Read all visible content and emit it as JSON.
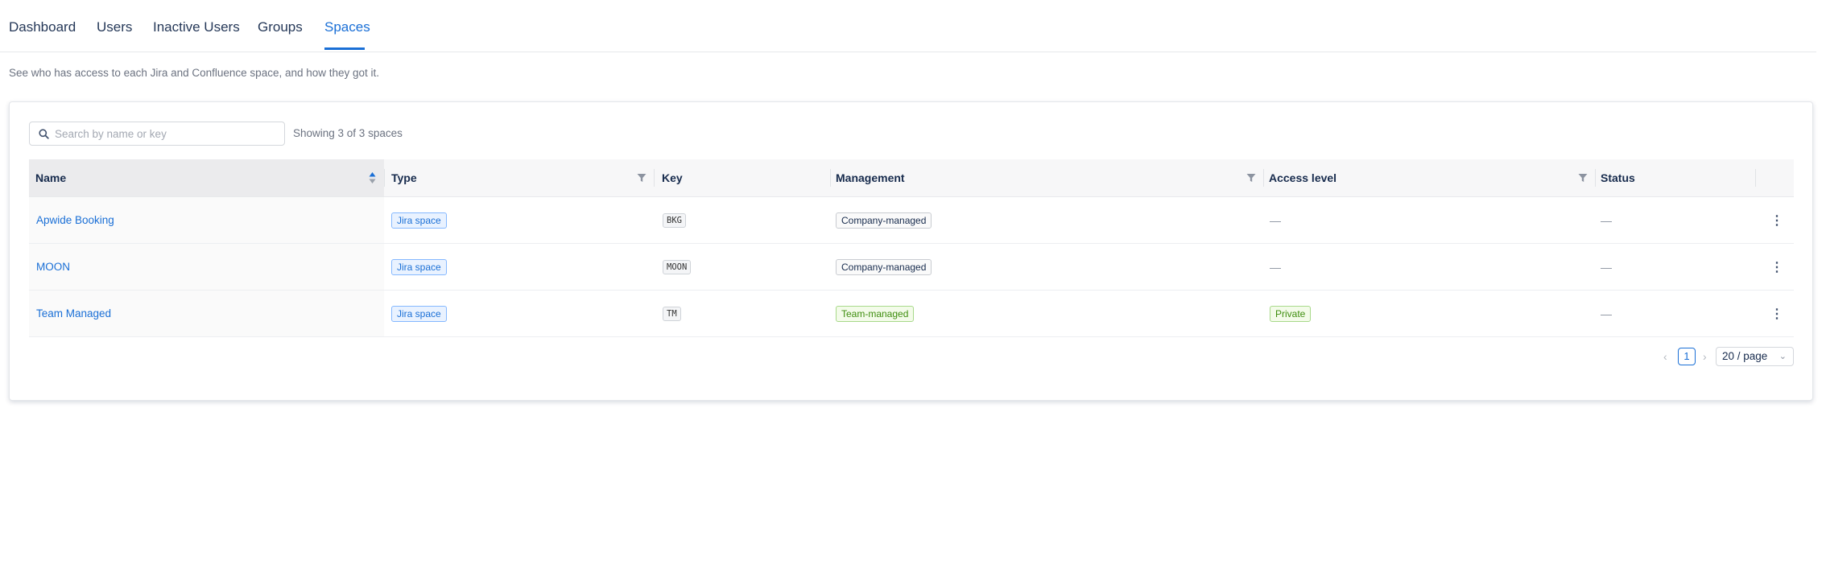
{
  "tabs": [
    {
      "label": "Dashboard"
    },
    {
      "label": "Users"
    },
    {
      "label": "Inactive Users"
    },
    {
      "label": "Groups"
    },
    {
      "label": "Spaces"
    }
  ],
  "active_tab": "Spaces",
  "description": "See who has access to each Jira and Confluence space, and how they got it.",
  "search": {
    "placeholder": "Search by name or key",
    "value": ""
  },
  "showing_text": "Showing 3 of 3 spaces",
  "table": {
    "columns": [
      "Name",
      "Type",
      "Key",
      "Management",
      "Access level",
      "Status"
    ],
    "rows": [
      {
        "name": "Apwide Booking",
        "type": "Jira space",
        "key": "BKG",
        "management": "Company-managed",
        "access_level": "—",
        "status": "—"
      },
      {
        "name": "MOON",
        "type": "Jira space",
        "key": "MOON",
        "management": "Company-managed",
        "access_level": "—",
        "status": "—"
      },
      {
        "name": "Team Managed",
        "type": "Jira space",
        "key": "TM",
        "management": "Team-managed",
        "access_level": "Private",
        "status": "—"
      }
    ]
  },
  "pagination": {
    "current_page": "1",
    "page_size": "20 / page"
  },
  "colors": {
    "accent": "#1a6fd6",
    "success": "#3f8e0f"
  }
}
